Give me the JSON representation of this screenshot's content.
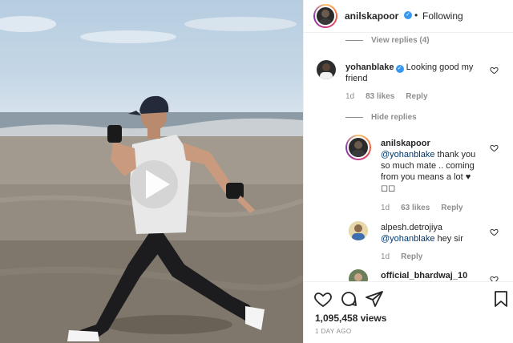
{
  "post": {
    "author": "anilskapoor",
    "dot": "•",
    "follow_status": "Following",
    "verified_mark": "✓"
  },
  "thread": {
    "view_replies": "View replies (4)",
    "hide_replies": "Hide replies",
    "comments": [
      {
        "user": "yohanblake",
        "verified": true,
        "text": "Looking good my friend",
        "age": "1d",
        "likes": "83 likes",
        "reply": "Reply"
      },
      {
        "user": "anilskapoor",
        "verified": true,
        "mention": "@yohanblake",
        "text": " thank you so much mate .. coming from you means a lot ♥ ◻︎◻︎",
        "age": "1d",
        "likes": "63 likes",
        "reply": "Reply"
      },
      {
        "user": "alpesh.detrojiya",
        "verified": false,
        "mention": "@yohanblake",
        "text": " hey sir",
        "age": "1d",
        "reply": "Reply"
      },
      {
        "user": "official_bhardwaj_10",
        "verified": false,
        "text": ""
      }
    ]
  },
  "stats": {
    "views": "1,095,458 views",
    "posted": "1 DAY AGO"
  },
  "icons": [
    "play-icon",
    "heart-icon",
    "comment-icon",
    "share-icon",
    "bookmark-icon"
  ],
  "colors": {
    "link": "#00376b",
    "muted": "#8e8e8e",
    "verified": "#3897f0",
    "text": "#262626"
  }
}
